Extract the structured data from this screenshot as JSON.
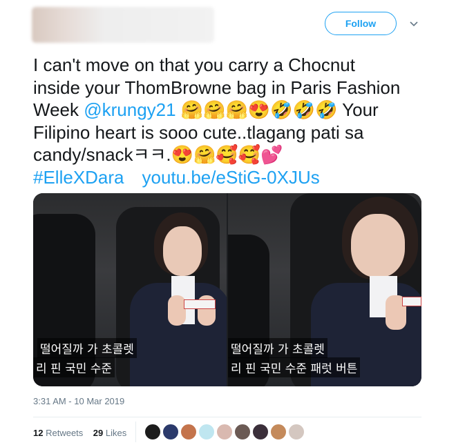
{
  "header": {
    "follow_label": "Follow"
  },
  "tweet": {
    "line1": "I can't move on that you carry a Chocnut",
    "line2": "inside your ThomBrowne bag in Paris Fashion",
    "line3_pre": "Week ",
    "mention": "@krungy21",
    "line3_emojis": " 🤗🤗🤗😍🤣🤣🤣 ",
    "line3_post": "Your",
    "line4": "Filipino heart is sooo cute..tlagang pati sa",
    "line5_pre": "candy/snackㅋㅋ.",
    "line5_emojis": "😍🤗🥰🥰💕",
    "hashtag": "#ElleXDara",
    "link": "youtu.be/eStiG-0XJUs"
  },
  "media": {
    "frame1": {
      "sub1": "떨어질까 가 초콜렛",
      "sub2": "리 핀 국민 수준"
    },
    "frame2": {
      "sub1": "떨어질까 가 초콜렛",
      "sub2": "리 핀 국민 수준 패럿 버튼"
    }
  },
  "timestamp": "3:31 AM - 10 Mar 2019",
  "stats": {
    "retweets_count": "12",
    "retweets_label": "Retweets",
    "likes_count": "29",
    "likes_label": "Likes"
  },
  "liker_colors": [
    "#1c1c1c",
    "#2b3a6b",
    "#c4744c",
    "#bfe6f0",
    "#d9b9b0",
    "#6b5a54",
    "#3b2f3a",
    "#c48a5b",
    "#d4c7c0"
  ],
  "colors": {
    "accent": "#1da1f2",
    "text": "#14171a",
    "muted": "#657786"
  }
}
